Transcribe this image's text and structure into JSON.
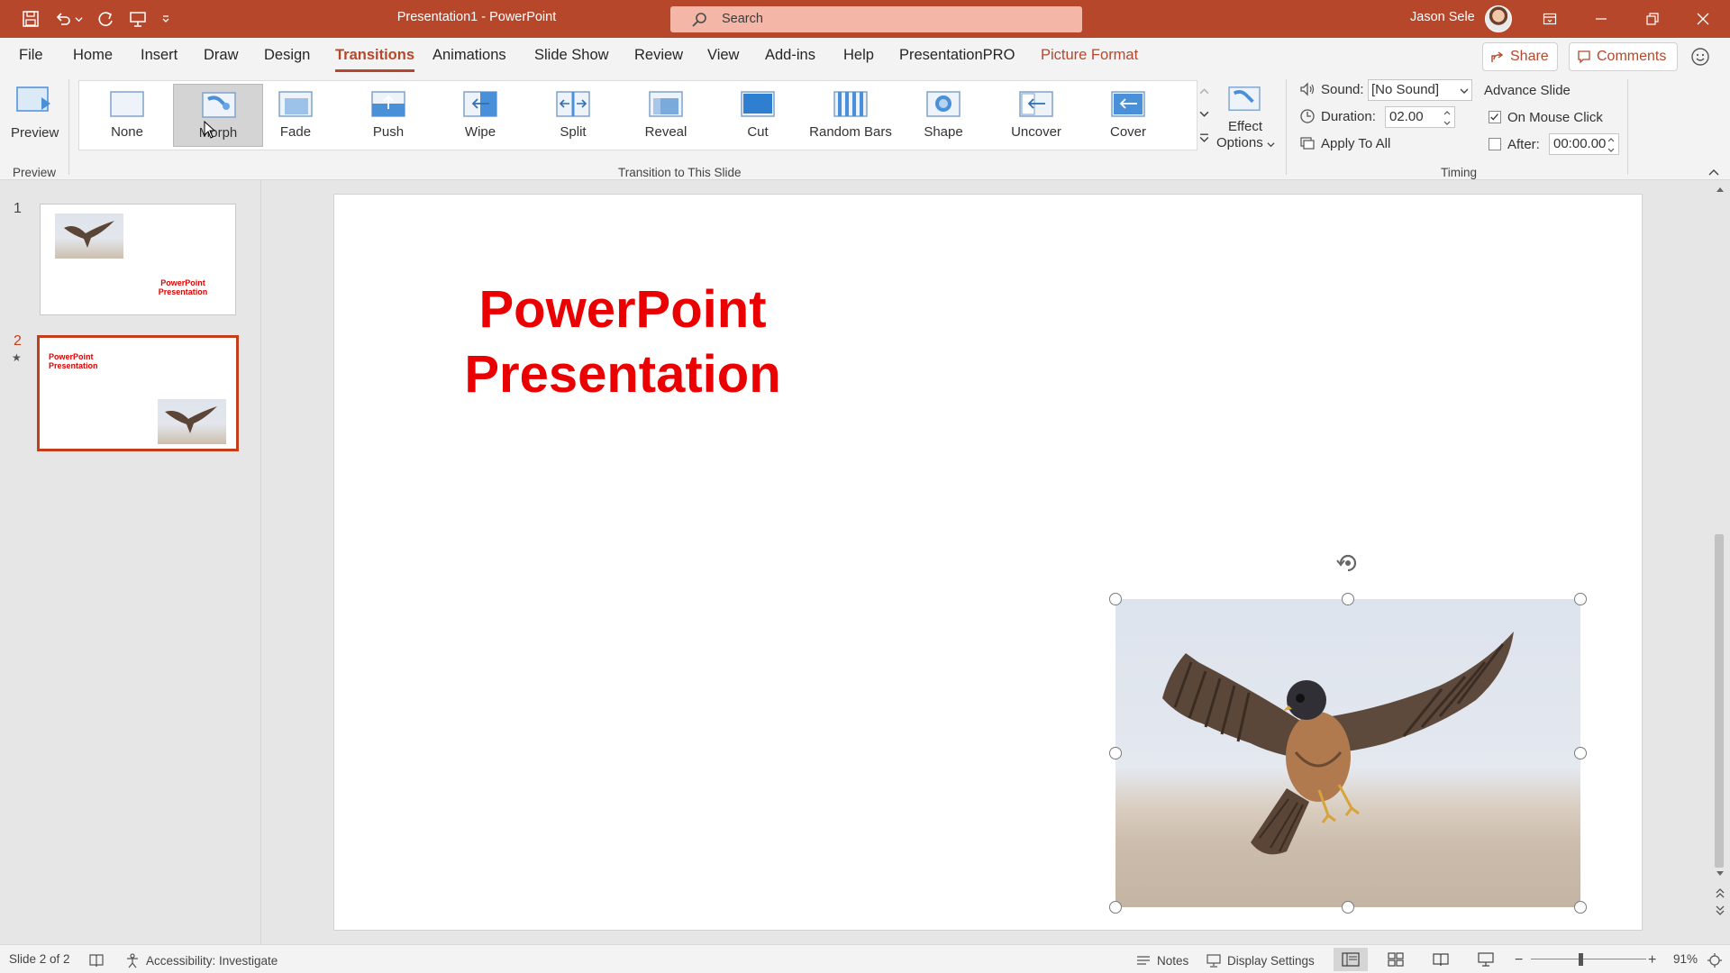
{
  "app": {
    "doc_title": "Presentation1 - PowerPoint",
    "search_placeholder": "Search",
    "user_name": "Jason Sele",
    "accent": "#b7472a"
  },
  "tabs": [
    {
      "label": "File"
    },
    {
      "label": "Home"
    },
    {
      "label": "Insert"
    },
    {
      "label": "Draw"
    },
    {
      "label": "Design"
    },
    {
      "label": "Transitions"
    },
    {
      "label": "Animations"
    },
    {
      "label": "Slide Show"
    },
    {
      "label": "Review"
    },
    {
      "label": "View"
    },
    {
      "label": "Add-ins"
    },
    {
      "label": "Help"
    },
    {
      "label": "PresentationPRO"
    },
    {
      "label": "Picture Format"
    }
  ],
  "active_tab": "Transitions",
  "header_buttons": {
    "share": "Share",
    "comments": "Comments"
  },
  "ribbon": {
    "preview": {
      "label": "Preview",
      "group": "Preview"
    },
    "transitions": [
      {
        "label": "None"
      },
      {
        "label": "Morph"
      },
      {
        "label": "Fade"
      },
      {
        "label": "Push"
      },
      {
        "label": "Wipe"
      },
      {
        "label": "Split"
      },
      {
        "label": "Reveal"
      },
      {
        "label": "Cut"
      },
      {
        "label": "Random Bars"
      },
      {
        "label": "Shape"
      },
      {
        "label": "Uncover"
      },
      {
        "label": "Cover"
      }
    ],
    "selected_transition": "Morph",
    "transition_group": "Transition to This Slide",
    "effect_options": {
      "line1": "Effect",
      "line2": "Options"
    },
    "timing": {
      "sound_label": "Sound:",
      "sound_value": "[No Sound]",
      "duration_label": "Duration:",
      "duration_value": "02.00",
      "apply_all": "Apply To All",
      "advance_title": "Advance Slide",
      "on_click_label": "On Mouse Click",
      "on_click_checked": true,
      "after_label": "After:",
      "after_value": "00:00.00",
      "after_checked": false,
      "group": "Timing"
    }
  },
  "thumbnails": [
    {
      "number": "1",
      "title_line1": "PowerPoint",
      "title_line2": "Presentation",
      "selected": false
    },
    {
      "number": "2",
      "title_line1": "PowerPoint",
      "title_line2": "Presentation",
      "selected": true
    }
  ],
  "slide": {
    "title_line1": "PowerPoint",
    "title_line2": "Presentation",
    "title_color": "#ea0000",
    "image": "falcon-photo"
  },
  "status": {
    "slide_of": "Slide 2 of 2",
    "accessibility": "Accessibility: Investigate",
    "notes": "Notes",
    "display_settings": "Display Settings",
    "zoom": "91%"
  }
}
